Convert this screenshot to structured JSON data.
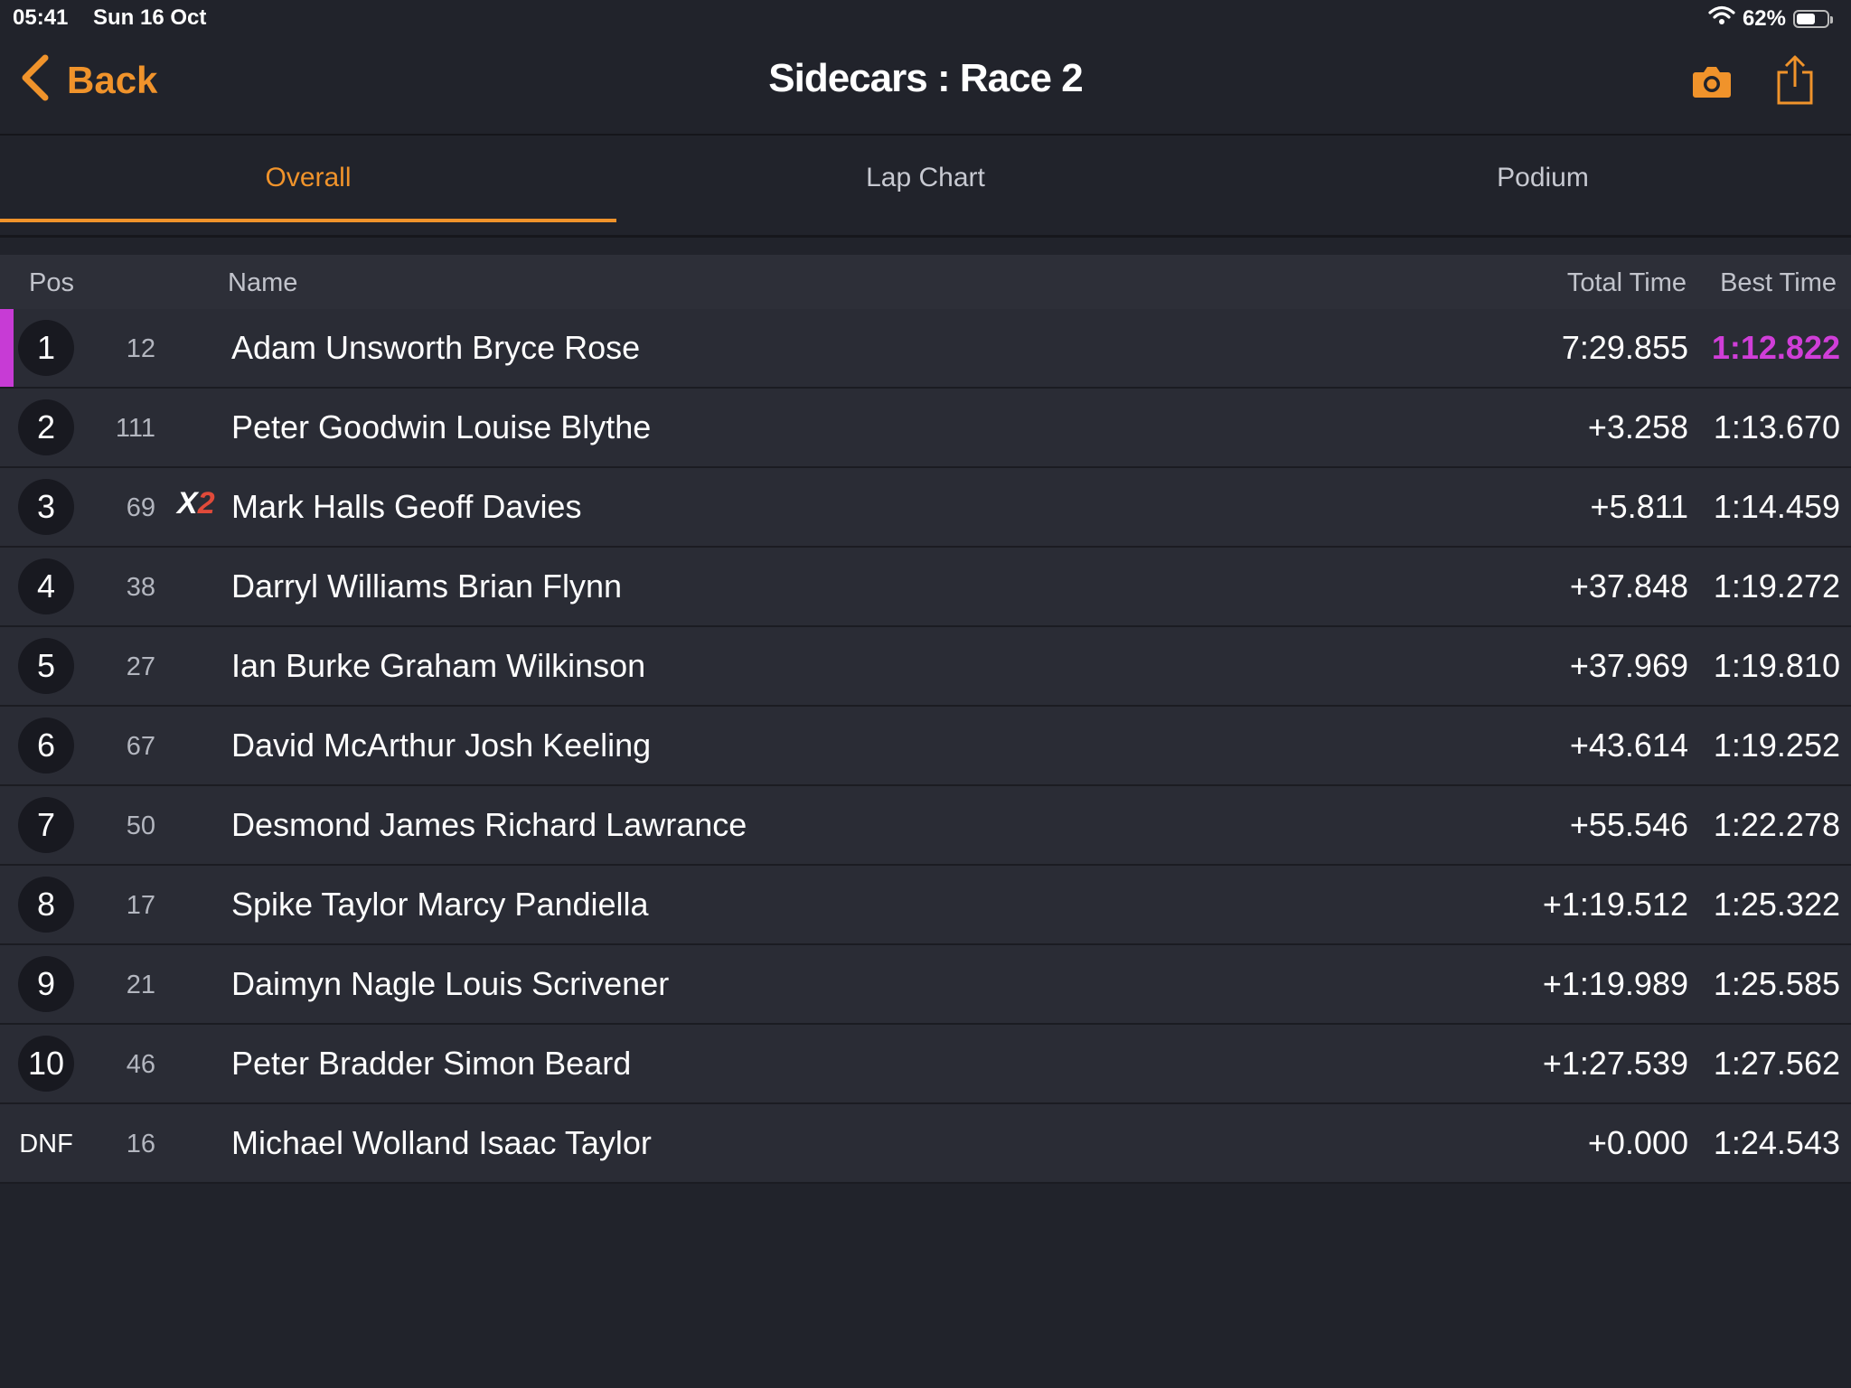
{
  "status_bar": {
    "time": "05:41",
    "date": "Sun 16 Oct",
    "battery": "62%",
    "battery_level": 0.62
  },
  "nav": {
    "back_label": "Back",
    "title": "Sidecars : Race 2",
    "camera_icon": "camera-icon",
    "share_icon": "share-icon"
  },
  "tabs": [
    {
      "label": "Overall",
      "active": true
    },
    {
      "label": "Lap Chart",
      "active": false
    },
    {
      "label": "Podium",
      "active": false
    }
  ],
  "table": {
    "headers": {
      "pos": "Pos",
      "name": "Name",
      "total_time": "Total Time",
      "best_time": "Best Time"
    },
    "rows": [
      {
        "pos": "1",
        "number": "12",
        "badge": "",
        "name": "Adam Unsworth Bryce  Rose",
        "total": "7:29.855",
        "best": "1:12.822",
        "fastest": true
      },
      {
        "pos": "2",
        "number": "111",
        "badge": "",
        "name": "Peter Goodwin Louise Blythe",
        "total": "+3.258",
        "best": "1:13.670",
        "fastest": false
      },
      {
        "pos": "3",
        "number": "69",
        "badge": "X2",
        "name": "Mark Halls Geoff Davies",
        "total": "+5.811",
        "best": "1:14.459",
        "fastest": false
      },
      {
        "pos": "4",
        "number": "38",
        "badge": "",
        "name": "Darryl  Williams Brian  Flynn",
        "total": "+37.848",
        "best": "1:19.272",
        "fastest": false
      },
      {
        "pos": "5",
        "number": "27",
        "badge": "",
        "name": "Ian Burke Graham Wilkinson",
        "total": "+37.969",
        "best": "1:19.810",
        "fastest": false
      },
      {
        "pos": "6",
        "number": "67",
        "badge": "",
        "name": "David McArthur Josh  Keeling",
        "total": "+43.614",
        "best": "1:19.252",
        "fastest": false
      },
      {
        "pos": "7",
        "number": "50",
        "badge": "",
        "name": "Desmond  James Richard Lawrance",
        "total": "+55.546",
        "best": "1:22.278",
        "fastest": false
      },
      {
        "pos": "8",
        "number": "17",
        "badge": "",
        "name": "Spike Taylor Marcy Pandiella",
        "total": "+1:19.512",
        "best": "1:25.322",
        "fastest": false
      },
      {
        "pos": "9",
        "number": "21",
        "badge": "",
        "name": "Daimyn Nagle Louis Scrivener",
        "total": "+1:19.989",
        "best": "1:25.585",
        "fastest": false
      },
      {
        "pos": "10",
        "number": "46",
        "badge": "",
        "name": "Peter Bradder Simon  Beard",
        "total": "+1:27.539",
        "best": "1:27.562",
        "fastest": false
      },
      {
        "pos": "DNF",
        "number": "16",
        "badge": "",
        "name": "Michael Wolland Isaac Taylor",
        "total": "+0.000",
        "best": "1:24.543",
        "fastest": false
      }
    ]
  },
  "colors": {
    "accent": "#f0932b",
    "fastest": "#d03ed8",
    "background": "#21232b"
  }
}
